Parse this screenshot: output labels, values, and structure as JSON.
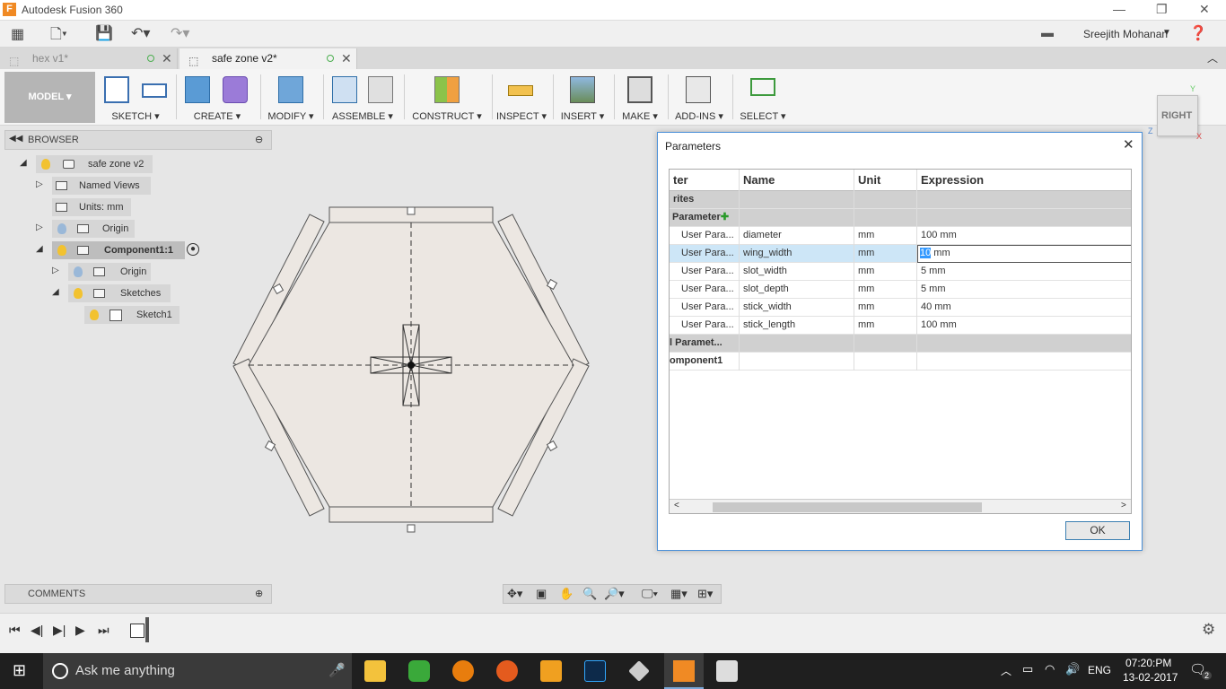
{
  "app": {
    "title": "Autodesk Fusion 360",
    "user": "Sreejith Mohanan"
  },
  "tabs": [
    {
      "label": "hex v1*"
    },
    {
      "label": "safe zone v2*"
    }
  ],
  "ribbon": {
    "workspace": "MODEL",
    "groups": [
      "SKETCH",
      "CREATE",
      "MODIFY",
      "ASSEMBLE",
      "CONSTRUCT",
      "INSPECT",
      "INSERT",
      "MAKE",
      "ADD-INS",
      "SELECT"
    ]
  },
  "browser": {
    "title": "BROWSER",
    "items": [
      "safe zone v2",
      "Named Views",
      "Units: mm",
      "Origin",
      "Component1:1",
      "Origin",
      "Sketches",
      "Sketch1"
    ]
  },
  "viewcube": {
    "face": "RIGHT",
    "x_label": "Z",
    "y_label": "Y",
    "z_label": "X"
  },
  "dialog": {
    "title": "Parameters",
    "columns": [
      "ter",
      "Name",
      "Unit",
      "Expression"
    ],
    "groups": {
      "favorites": "rites",
      "user": "Parameter",
      "model": "l Paramet...",
      "component": "omponent1"
    },
    "rows": [
      {
        "type": "User Para...",
        "name": "diameter",
        "unit": "mm",
        "expr": "100 mm"
      },
      {
        "type": "User Para...",
        "name": "wing_width",
        "unit": "mm",
        "expr_sel": "10",
        "expr_rest": " mm"
      },
      {
        "type": "User Para...",
        "name": "slot_width",
        "unit": "mm",
        "expr": "5 mm"
      },
      {
        "type": "User Para...",
        "name": "slot_depth",
        "unit": "mm",
        "expr": "5 mm"
      },
      {
        "type": "User Para...",
        "name": "stick_width",
        "unit": "mm",
        "expr": "40 mm"
      },
      {
        "type": "User Para...",
        "name": "stick_length",
        "unit": "mm",
        "expr": "100 mm"
      }
    ],
    "ok": "OK"
  },
  "comments": {
    "title": "COMMENTS"
  },
  "taskbar": {
    "search": "Ask me anything",
    "lang": "ENG",
    "time": "07:20:PM",
    "date": "13-02-2017",
    "notif": "2"
  },
  "colors": {
    "accent": "#0078d7",
    "orange": "#f08a24",
    "selectedRow": "#cde6f7"
  }
}
